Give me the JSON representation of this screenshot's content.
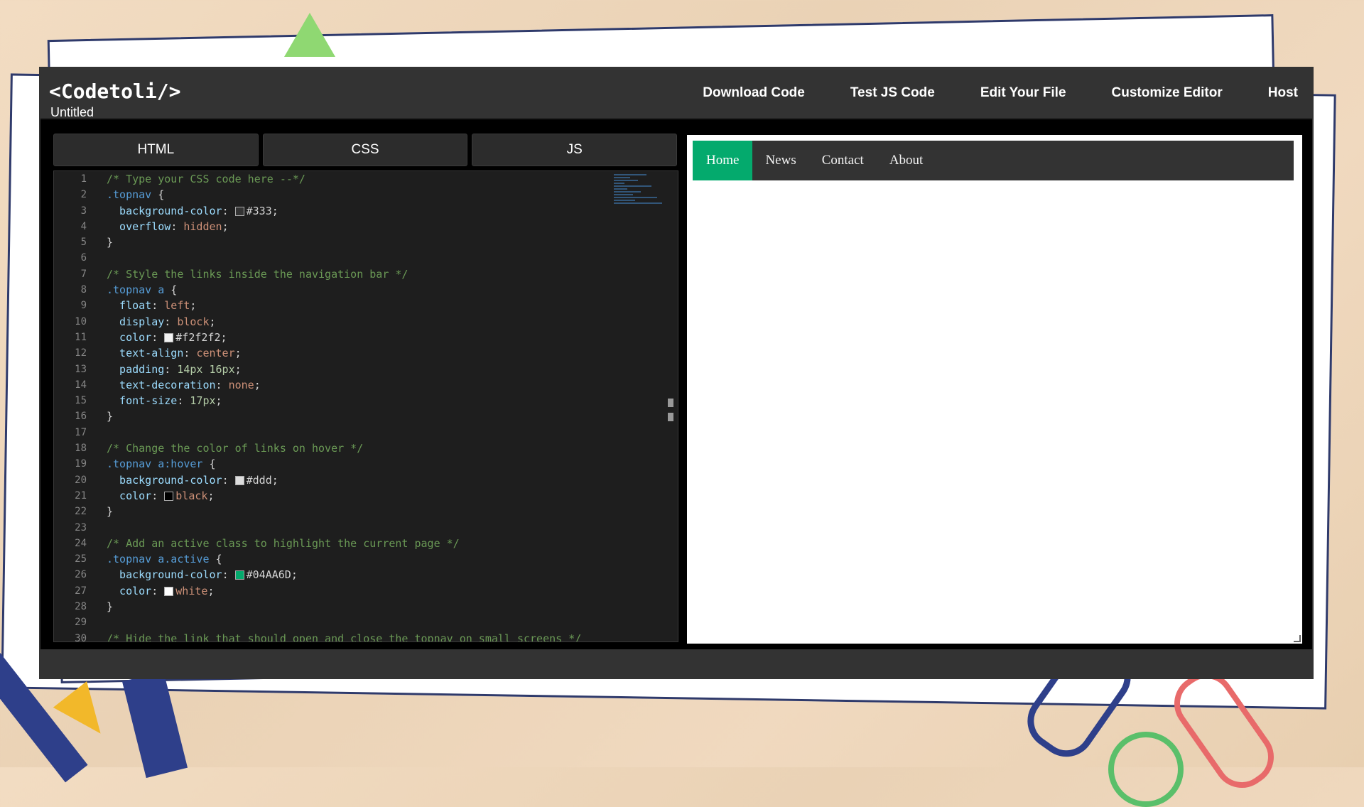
{
  "app": {
    "logo": "<Codetoli/>",
    "file_name": "Untitled"
  },
  "nav": [
    "Download Code",
    "Test JS Code",
    "Edit Your File",
    "Customize Editor",
    "Host"
  ],
  "tabs": [
    "HTML",
    "CSS",
    "JS"
  ],
  "editor": {
    "active_tab": "CSS",
    "lines": [
      [
        {
          "t": "/* Type your CSS code here --*/",
          "c": "comment"
        }
      ],
      [
        {
          "t": ".topnav",
          "c": "selb"
        },
        {
          "t": " {",
          "c": "punc"
        }
      ],
      [
        {
          "t": "  background-color",
          "c": "prop"
        },
        {
          "t": ": ",
          "c": "punc"
        },
        {
          "t": "",
          "c": "swatch",
          "color": "#333333"
        },
        {
          "t": "#333",
          "c": "punc"
        },
        {
          "t": ";",
          "c": "punc"
        }
      ],
      [
        {
          "t": "  overflow",
          "c": "prop"
        },
        {
          "t": ": ",
          "c": "punc"
        },
        {
          "t": "hidden",
          "c": "val"
        },
        {
          "t": ";",
          "c": "punc"
        }
      ],
      [
        {
          "t": "}",
          "c": "punc"
        }
      ],
      [],
      [
        {
          "t": "/* Style the links inside the navigation bar */",
          "c": "comment"
        }
      ],
      [
        {
          "t": ".topnav a",
          "c": "selb"
        },
        {
          "t": " {",
          "c": "punc"
        }
      ],
      [
        {
          "t": "  float",
          "c": "prop"
        },
        {
          "t": ": ",
          "c": "punc"
        },
        {
          "t": "left",
          "c": "val"
        },
        {
          "t": ";",
          "c": "punc"
        }
      ],
      [
        {
          "t": "  display",
          "c": "prop"
        },
        {
          "t": ": ",
          "c": "punc"
        },
        {
          "t": "block",
          "c": "val"
        },
        {
          "t": ";",
          "c": "punc"
        }
      ],
      [
        {
          "t": "  color",
          "c": "prop"
        },
        {
          "t": ": ",
          "c": "punc"
        },
        {
          "t": "",
          "c": "swatch",
          "color": "#f2f2f2"
        },
        {
          "t": "#f2f2f2",
          "c": "punc"
        },
        {
          "t": ";",
          "c": "punc"
        }
      ],
      [
        {
          "t": "  text-align",
          "c": "prop"
        },
        {
          "t": ": ",
          "c": "punc"
        },
        {
          "t": "center",
          "c": "val"
        },
        {
          "t": ";",
          "c": "punc"
        }
      ],
      [
        {
          "t": "  padding",
          "c": "prop"
        },
        {
          "t": ": ",
          "c": "punc"
        },
        {
          "t": "14px 16px",
          "c": "num"
        },
        {
          "t": ";",
          "c": "punc"
        }
      ],
      [
        {
          "t": "  text-decoration",
          "c": "prop"
        },
        {
          "t": ": ",
          "c": "punc"
        },
        {
          "t": "none",
          "c": "val"
        },
        {
          "t": ";",
          "c": "punc"
        }
      ],
      [
        {
          "t": "  font-size",
          "c": "prop"
        },
        {
          "t": ": ",
          "c": "punc"
        },
        {
          "t": "17px",
          "c": "num"
        },
        {
          "t": ";",
          "c": "punc"
        }
      ],
      [
        {
          "t": "}",
          "c": "punc"
        }
      ],
      [],
      [
        {
          "t": "/* Change the color of links on hover */",
          "c": "comment"
        }
      ],
      [
        {
          "t": ".topnav a:hover",
          "c": "selb"
        },
        {
          "t": " {",
          "c": "punc"
        }
      ],
      [
        {
          "t": "  background-color",
          "c": "prop"
        },
        {
          "t": ": ",
          "c": "punc"
        },
        {
          "t": "",
          "c": "swatch",
          "color": "#dddddd"
        },
        {
          "t": "#ddd",
          "c": "punc"
        },
        {
          "t": ";",
          "c": "punc"
        }
      ],
      [
        {
          "t": "  color",
          "c": "prop"
        },
        {
          "t": ": ",
          "c": "punc"
        },
        {
          "t": "",
          "c": "swatch",
          "color": "#000000"
        },
        {
          "t": "black",
          "c": "val"
        },
        {
          "t": ";",
          "c": "punc"
        }
      ],
      [
        {
          "t": "}",
          "c": "punc"
        }
      ],
      [],
      [
        {
          "t": "/* Add an active class to highlight the current page */",
          "c": "comment"
        }
      ],
      [
        {
          "t": ".topnav a.active",
          "c": "selb"
        },
        {
          "t": " {",
          "c": "punc"
        }
      ],
      [
        {
          "t": "  background-color",
          "c": "prop"
        },
        {
          "t": ": ",
          "c": "punc"
        },
        {
          "t": "",
          "c": "swatch",
          "color": "#04AA6D"
        },
        {
          "t": "#04AA6D",
          "c": "punc"
        },
        {
          "t": ";",
          "c": "punc"
        }
      ],
      [
        {
          "t": "  color",
          "c": "prop"
        },
        {
          "t": ": ",
          "c": "punc"
        },
        {
          "t": "",
          "c": "swatch",
          "color": "#ffffff"
        },
        {
          "t": "white",
          "c": "val"
        },
        {
          "t": ";",
          "c": "punc"
        }
      ],
      [
        {
          "t": "}",
          "c": "punc"
        }
      ],
      [],
      [
        {
          "t": "/* Hide the link that should open and close the topnav on small screens */",
          "c": "comment"
        }
      ]
    ]
  },
  "preview": {
    "links": [
      "Home",
      "News",
      "Contact",
      "About"
    ],
    "active": "Home",
    "active_color": "#04AA6D",
    "nav_bg": "#333333"
  }
}
